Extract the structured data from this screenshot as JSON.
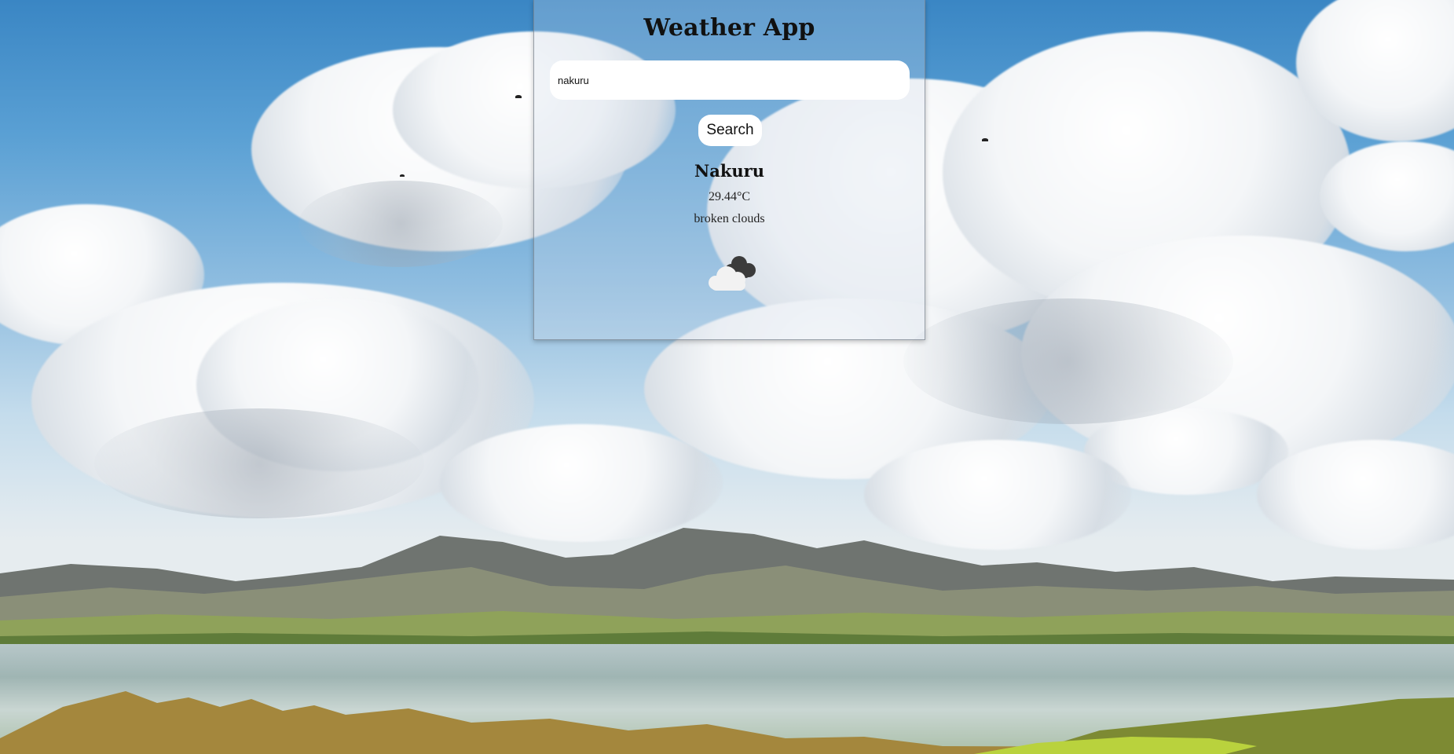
{
  "app": {
    "title": "Weather App"
  },
  "search": {
    "value": "nakuru",
    "button_label": "Search"
  },
  "weather": {
    "city": "Nakuru",
    "temperature": "29.44°C",
    "description": "broken clouds",
    "icon": "broken-clouds-icon"
  },
  "colors": {
    "card_border": "#7d8a96",
    "text": "#111111",
    "input_bg": "#ffffff"
  }
}
